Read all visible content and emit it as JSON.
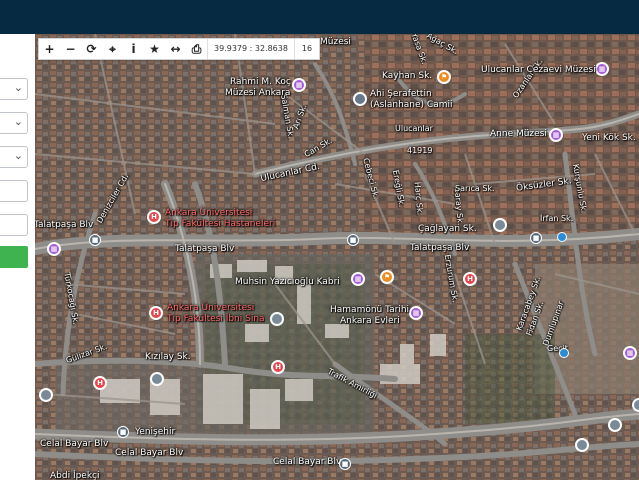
{
  "map": {
    "streets": [
      {
        "id": "s1",
        "text": "Talatpaşa Blv"
      },
      {
        "id": "s2",
        "text": "Talatpaşa Blv"
      },
      {
        "id": "s3",
        "text": "Talatpaşa Blv"
      },
      {
        "id": "s4",
        "text": "Ulucanlar Cd."
      },
      {
        "id": "s5",
        "text": "Kızılay Sk."
      },
      {
        "id": "s6",
        "text": "Celal Bayar Blv"
      },
      {
        "id": "s7",
        "text": "Celal Bayar Blv"
      },
      {
        "id": "s8",
        "text": "Celal Bayar Blv"
      },
      {
        "id": "s9",
        "text": "Çağlayan Sk."
      },
      {
        "id": "s10",
        "text": "Kayhan Sk."
      },
      {
        "id": "s11",
        "text": "Yeni Kök Sk."
      },
      {
        "id": "s12",
        "text": "Öksüzler Sk."
      },
      {
        "id": "s13",
        "text": "Denizciler Cd."
      },
      {
        "id": "s14",
        "text": "Türkocağı Sk."
      },
      {
        "id": "s15",
        "text": "Trafik Amirliği"
      },
      {
        "id": "s16",
        "text": "Yenişehir"
      },
      {
        "id": "s17",
        "text": "Abdi İpekçi"
      },
      {
        "id": "s18",
        "text": "Karacabey Sk."
      },
      {
        "id": "s19",
        "text": "Fidan Sk."
      },
      {
        "id": "s20",
        "text": "Dumlupınar"
      },
      {
        "id": "s21",
        "text": "Geçit"
      },
      {
        "id": "s22",
        "text": "Salman Sk."
      },
      {
        "id": "s23",
        "text": "Arı Sk."
      },
      {
        "id": "s24",
        "text": "Can Sk."
      },
      {
        "id": "s25",
        "text": "Yasa Sk."
      },
      {
        "id": "s26",
        "text": "Ağaç Sk."
      },
      {
        "id": "s27",
        "text": "Ozanlar Sk."
      },
      {
        "id": "s28",
        "text": "Cebeci Sk."
      },
      {
        "id": "s29",
        "text": "Ereğli Sk."
      },
      {
        "id": "s30",
        "text": "Harç Sk."
      },
      {
        "id": "s31",
        "text": "Saray Sk."
      },
      {
        "id": "s32",
        "text": "Erzurum Sk."
      },
      {
        "id": "s33",
        "text": "Kurşunlu Sk."
      },
      {
        "id": "s34",
        "text": "Ulucanlar"
      },
      {
        "id": "s35",
        "text": "Sarıca Sk."
      },
      {
        "id": "s36",
        "text": "İrfan Sk."
      },
      {
        "id": "s37",
        "text": "Müzesi"
      },
      {
        "id": "s38",
        "text": "Gülizar Sk."
      }
    ],
    "pois": [
      {
        "id": "p1",
        "line1": "Ankara Üniversitesi",
        "line2": "Tıp Fakültesi Hastaneleri",
        "type": "hosp"
      },
      {
        "id": "p2",
        "line1": "Ankara Üniversitesi",
        "line2": "Tıp Fakültesi İbni Sina",
        "type": "hosp"
      },
      {
        "id": "p3",
        "line1": "Rahmi M. Koç",
        "line2": "Müzesi Ankara",
        "type": "museum"
      },
      {
        "id": "p4",
        "line1": "Ahi Şerafettin",
        "line2": "(Aslanhane) Camii",
        "type": "mosque"
      },
      {
        "id": "p5",
        "line1": "Ulucanlar Cezaevi Müzesi",
        "line2": "",
        "type": "museum"
      },
      {
        "id": "p6",
        "line1": "Anne Müzesi",
        "line2": "",
        "type": "museum"
      },
      {
        "id": "p7",
        "line1": "Muhsin Yazıcıoğlu Kabri",
        "line2": "",
        "type": "museum"
      },
      {
        "id": "p8",
        "line1": "Hamamönü Tarihi",
        "line2": "Ankara Evleri",
        "type": "museum"
      },
      {
        "id": "p9",
        "line1": "41919",
        "line2": "",
        "type": "none"
      }
    ],
    "icons": {
      "hospital": "H",
      "bus": "■",
      "museum": "▦",
      "food": "⚑"
    }
  },
  "toolbar": {
    "zoom_in": "+",
    "zoom_out": "−",
    "refresh": "⟳",
    "locate": "⌖",
    "info": "i",
    "favorite": "★",
    "measure": "↔",
    "print": "⎙",
    "coordinates": "39.9379 : 32.8638",
    "zoom_level": "16"
  },
  "panel": {
    "dropdown_chevron": "⌄"
  }
}
